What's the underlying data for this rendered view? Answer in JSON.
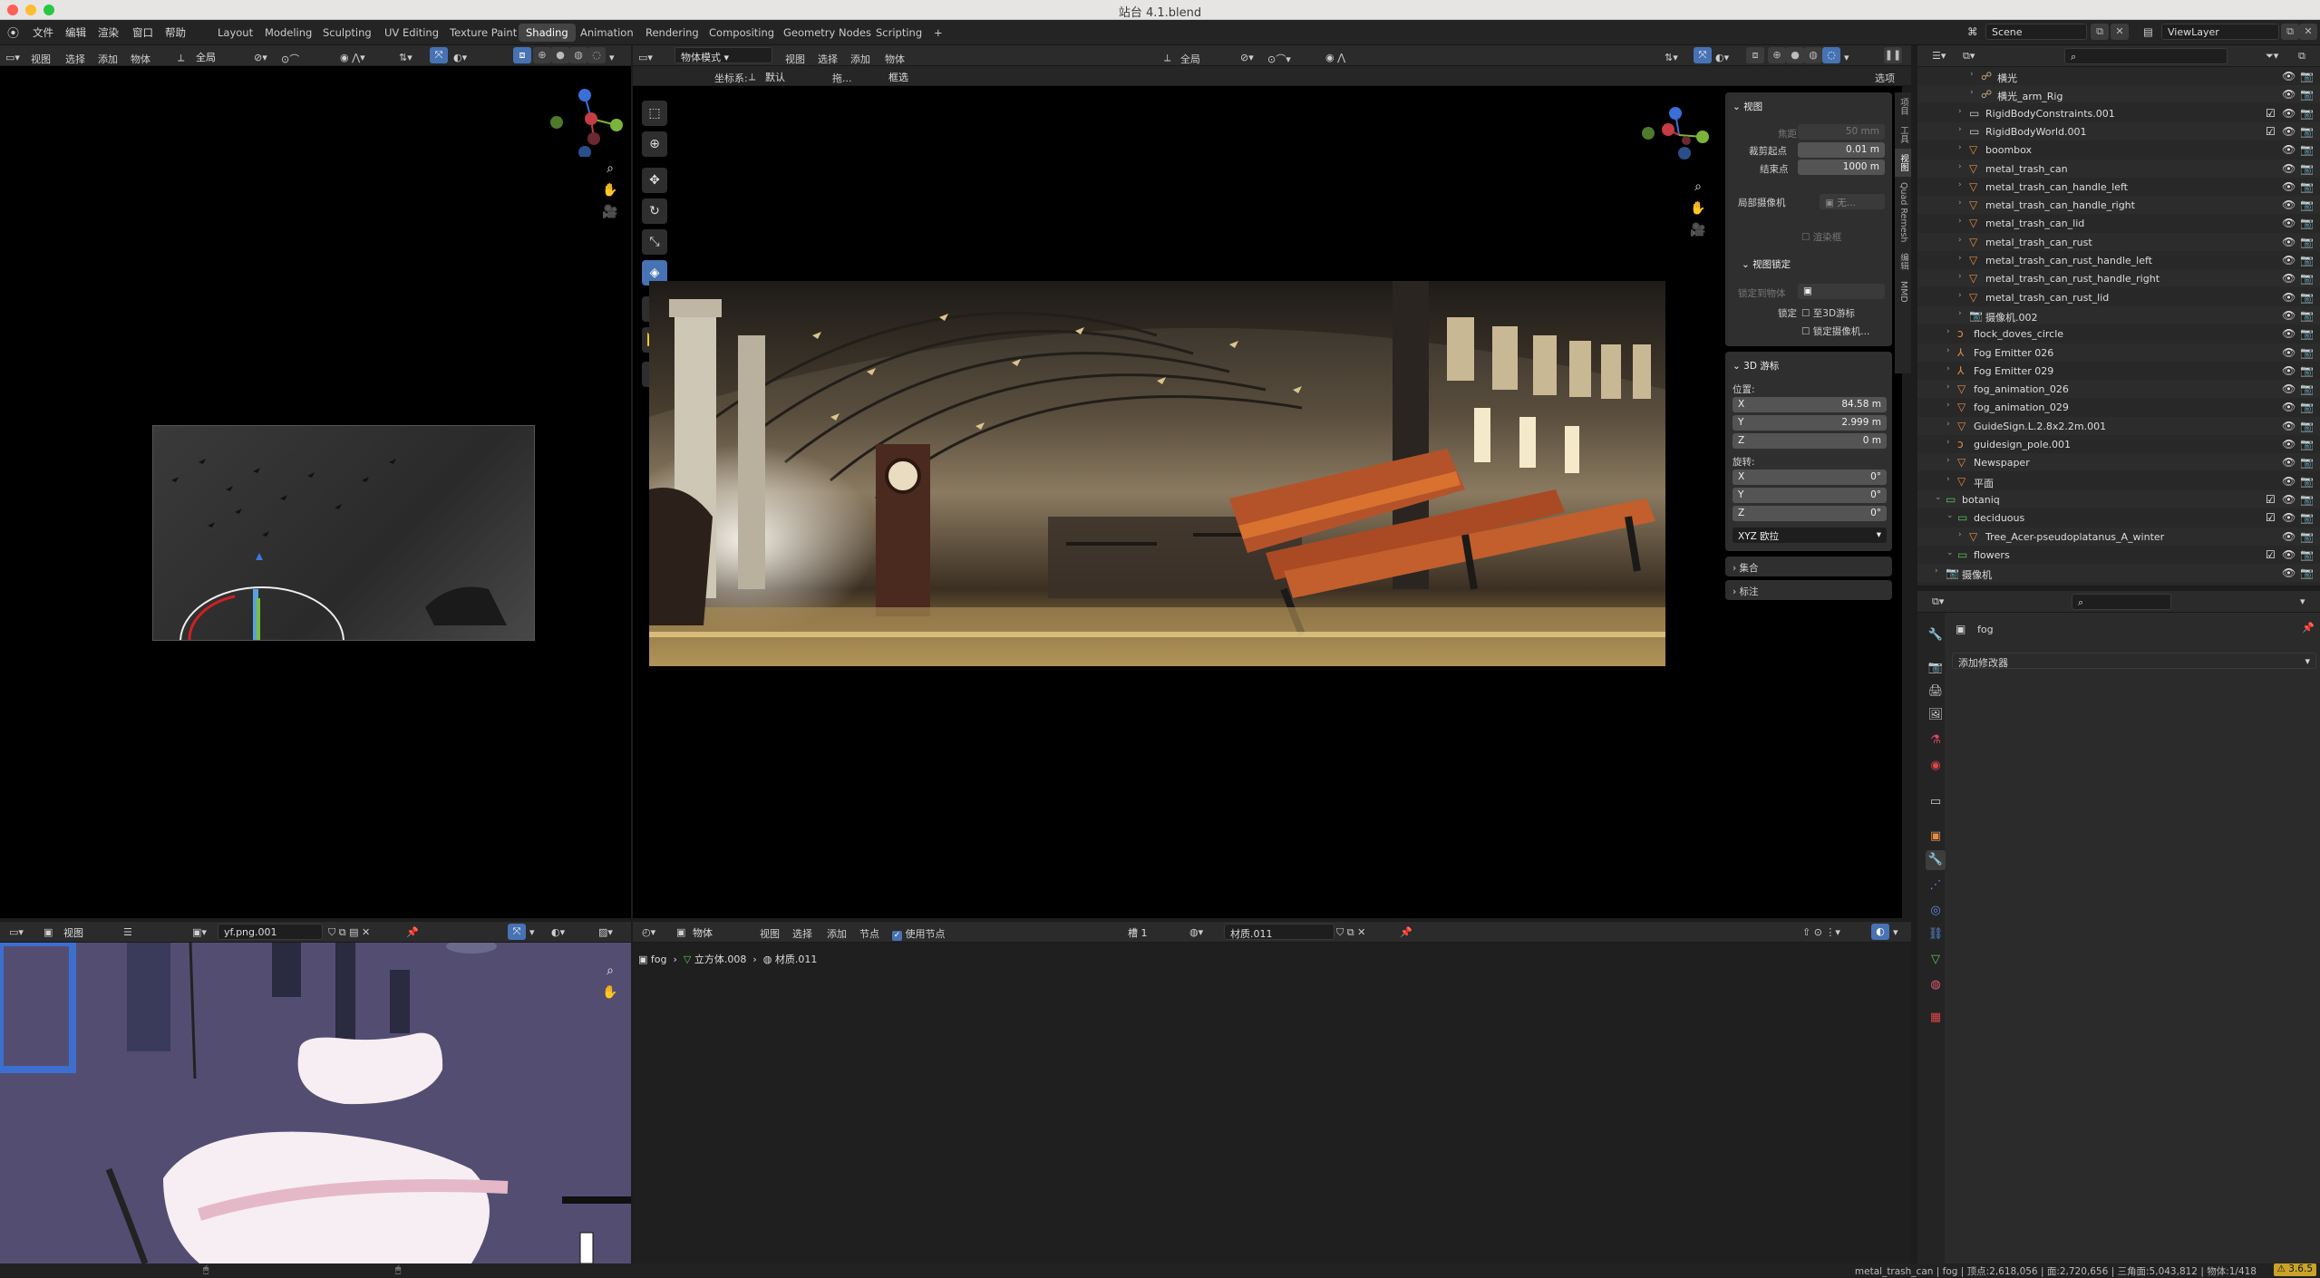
{
  "window": {
    "title": "站台 4.1.blend"
  },
  "topmenu": {
    "items": [
      "文件",
      "编辑",
      "渲染",
      "窗口",
      "帮助"
    ],
    "workspaces": [
      "Layout",
      "Modeling",
      "Sculpting",
      "UV Editing",
      "Texture Paint",
      "Shading",
      "Animation",
      "Rendering",
      "Compositing",
      "Geometry Nodes",
      "Scripting"
    ],
    "active_workspace": "Shading",
    "add_tab": "+",
    "scene": "Scene",
    "view_layer": "ViewLayer"
  },
  "left_viewport": {
    "menus": [
      "视图",
      "选择",
      "添加",
      "物体"
    ],
    "transform": "全局"
  },
  "main_viewport": {
    "mode": "物体模式",
    "menus": [
      "视图",
      "选择",
      "添加",
      "物体"
    ],
    "transform": "全局",
    "coord_label": "坐标系:",
    "coord_value": "默认",
    "drag_label": "拖...",
    "select_mode": "框选",
    "options": "选项"
  },
  "npanel": {
    "view_header": "视图",
    "focal_label": "焦距",
    "focal_value": "50 mm",
    "clip_start_label": "裁剪起点",
    "clip_start_value": "0.01 m",
    "clip_end_label": "结束点",
    "clip_end_value": "1000 m",
    "local_camera_label": "局部摄像机",
    "local_camera_value": "无...",
    "render_region": "渲染框",
    "view_lock_header": "视图锁定",
    "lock_to_object": "锁定到物体",
    "lock_label": "锁定",
    "lock_3d_cursor": "至3D游标",
    "lock_camera": "锁定摄像机...",
    "cursor_header": "3D 游标",
    "location_label": "位置:",
    "loc_x": "84.58 m",
    "loc_y": "2.999 m",
    "loc_z": "0 m",
    "rotation_label": "旋转:",
    "rot_x": "0°",
    "rot_y": "0°",
    "rot_z": "0°",
    "rotation_mode": "XYZ 欧拉",
    "collections_header": "集合",
    "annotations_header": "标注",
    "side_tabs": [
      "项目",
      "工具",
      "视图",
      "Quad Remesh",
      "编辑",
      "MMD"
    ]
  },
  "outliner": {
    "search_placeholder": "",
    "rows": [
      {
        "name": "横光",
        "indent": 4,
        "icon": "armature",
        "check": false
      },
      {
        "name": "横光_arm_Rig",
        "indent": 4,
        "icon": "armature",
        "check": false
      },
      {
        "name": "RigidBodyConstraints.001",
        "indent": 3,
        "icon": "object",
        "check": true
      },
      {
        "name": "RigidBodyWorld.001",
        "indent": 3,
        "icon": "object",
        "check": true
      },
      {
        "name": "boombox",
        "indent": 3,
        "icon": "mesh",
        "check": false
      },
      {
        "name": "metal_trash_can",
        "indent": 3,
        "icon": "mesh",
        "check": false
      },
      {
        "name": "metal_trash_can_handle_left",
        "indent": 3,
        "icon": "mesh",
        "check": false
      },
      {
        "name": "metal_trash_can_handle_right",
        "indent": 3,
        "icon": "mesh",
        "check": false
      },
      {
        "name": "metal_trash_can_lid",
        "indent": 3,
        "icon": "mesh",
        "check": false
      },
      {
        "name": "metal_trash_can_rust",
        "indent": 3,
        "icon": "mesh",
        "check": false
      },
      {
        "name": "metal_trash_can_rust_handle_left",
        "indent": 3,
        "icon": "mesh",
        "check": false
      },
      {
        "name": "metal_trash_can_rust_handle_right",
        "indent": 3,
        "icon": "mesh",
        "check": false
      },
      {
        "name": "metal_trash_can_rust_lid",
        "indent": 3,
        "icon": "mesh",
        "check": false
      },
      {
        "name": "摄像机.002",
        "indent": 3,
        "icon": "camera",
        "check": false
      },
      {
        "name": "flock_doves_circle",
        "indent": 2,
        "icon": "curve",
        "check": false
      },
      {
        "name": "Fog Emitter 026",
        "indent": 2,
        "icon": "empty",
        "check": false
      },
      {
        "name": "Fog Emitter 029",
        "indent": 2,
        "icon": "empty",
        "check": false
      },
      {
        "name": "fog_animation_026",
        "indent": 2,
        "icon": "mesh",
        "check": false
      },
      {
        "name": "fog_animation_029",
        "indent": 2,
        "icon": "mesh",
        "check": false
      },
      {
        "name": "GuideSign.L.2.8x2.2m.001",
        "indent": 2,
        "icon": "mesh",
        "check": false
      },
      {
        "name": "guidesign_pole.001",
        "indent": 2,
        "icon": "curve",
        "check": false
      },
      {
        "name": "Newspaper",
        "indent": 2,
        "icon": "mesh",
        "check": false
      },
      {
        "name": "平面",
        "indent": 2,
        "icon": "mesh",
        "check": false
      },
      {
        "name": "botaniq",
        "indent": 1,
        "icon": "collection",
        "check": true
      },
      {
        "name": "deciduous",
        "indent": 2,
        "icon": "collection",
        "check": true
      },
      {
        "name": "Tree_Acer-pseudoplatanus_A_winter",
        "indent": 3,
        "icon": "mesh",
        "check": false
      },
      {
        "name": "flowers",
        "indent": 2,
        "icon": "collection",
        "check": true
      },
      {
        "name": "摄像机",
        "indent": 1,
        "icon": "camera",
        "check": false
      }
    ]
  },
  "properties": {
    "object_name": "fog",
    "add_modifier": "添加修改器"
  },
  "image_editor": {
    "view_menu": "视图",
    "image_name": "yf.png.001"
  },
  "node_editor": {
    "object_menu": "物体",
    "menus": [
      "视图",
      "选择",
      "添加",
      "节点"
    ],
    "use_nodes": "使用节点",
    "slot": "槽 1",
    "material": "材质.011",
    "breadcrumb": [
      "fog",
      "立方体.008",
      "材质.011"
    ]
  },
  "status": {
    "text": "metal_trash_can | fog | 顶点:2,618,056 | 面:2,720,656 | 三角面:5,043,812 | 物体:1/418",
    "version": "3.6.5"
  },
  "colors": {
    "accent": "#4772b3",
    "mesh_icon": "#e28d46",
    "data_icon": "#56c45a"
  }
}
